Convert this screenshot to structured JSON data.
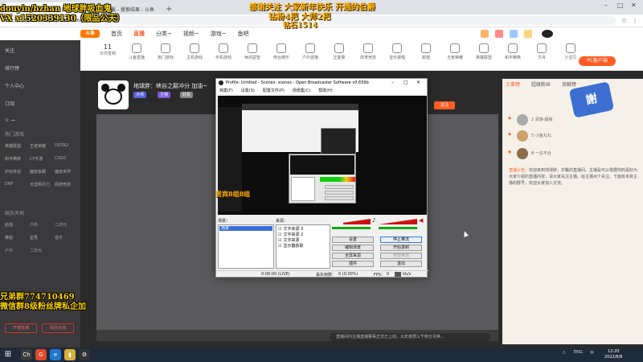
{
  "browser": {
    "tabs": [
      "【斗鱼】你的个人直播平台",
      "地球胖：护鬣 - 搜索结果 - 斗鱼"
    ],
    "new_tab": "+",
    "url": "https://www.douyu.com"
  },
  "site": {
    "logo": "斗鱼",
    "nav": [
      "首页",
      "直播",
      "分类~",
      "视频~",
      "游戏~",
      "鱼吧"
    ],
    "nav_active_index": 1,
    "categories": [
      {
        "label": "11",
        "sub": "日日签到"
      },
      {
        "label": "",
        "sub": "斗鱼直播"
      },
      {
        "label": "",
        "sub": "热门游戏"
      },
      {
        "label": "",
        "sub": "主机游戏"
      },
      {
        "label": "",
        "sub": "手机游戏"
      },
      {
        "label": "",
        "sub": "休闲益智"
      },
      {
        "label": "",
        "sub": "电台娱乐"
      },
      {
        "label": "",
        "sub": "户外直播"
      },
      {
        "label": "",
        "sub": "正能量"
      },
      {
        "label": "",
        "sub": "体育竞技"
      },
      {
        "label": "",
        "sub": "音乐歌唱"
      },
      {
        "label": "",
        "sub": "颜值"
      },
      {
        "label": "",
        "sub": "王者荣耀"
      },
      {
        "label": "",
        "sub": "英雄联盟"
      },
      {
        "label": "",
        "sub": "和平精英"
      },
      {
        "label": "",
        "sub": "方舟"
      },
      {
        "label": "",
        "sub": "小宝贝"
      }
    ],
    "pc_button": "PC客户端"
  },
  "sidebar": {
    "items": [
      "关注",
      "排行榜",
      "个人中心",
      "订阅"
    ],
    "section_hot": "热门游戏",
    "hot_grid": [
      "英雄联盟",
      "王者荣耀",
      "DOTA2",
      "和平精英",
      "CF手游",
      "CSGO",
      "炉石传说",
      "魔兽争霸",
      "魔兽世界",
      "DNF",
      "天涯明月刀",
      "网游竞技"
    ],
    "section_ent": "娱乐天地",
    "ent_grid": [
      "颜值",
      "户外",
      "二次元",
      "舞蹈",
      "星秀",
      "音乐",
      "户外",
      "二次元"
    ],
    "btn_left": "开播直播",
    "btn_right": "找回充值"
  },
  "room": {
    "streamer": "地球胖",
    "title": "峡谷之巅冲分 加油~",
    "tags": [
      "大师",
      "主播",
      "好友"
    ],
    "follow": "关注",
    "notice": "直播间内主播直播赛事正式已上线，大年夜攒三千积分兑换..."
  },
  "right_panel": {
    "tabs": [
      "土豪榜",
      "超级粉丝",
      "贡献榜"
    ],
    "mascot": "謝",
    "ranks": [
      "2 贵族-超级",
      "5 小鱼丸丸",
      "8 一言不合"
    ],
    "announcement_label": "直播公告：",
    "announcement": "欢迎来到地球胖，护鬣的直播间。主播是可以根据你的喜好为大家介绍的直播内容，请大家关注主播，给主播点个关注。下面有本房主播的群号，欢迎大家加入交流。"
  },
  "obs": {
    "title": "Profile: Untitled - Scenes: scenes - Open Broadcaster Software v0.659b",
    "menu": [
      "档案(F)",
      "设置(S)",
      "配置文件(P)",
      "场景集(C)",
      "帮助(H)"
    ],
    "scenes_label": "场景：",
    "scene_selected": "场景",
    "sources_label": "来源：",
    "sources": [
      "文字来源 3",
      "文字来源 2",
      "文字来源",
      "显示器获取"
    ],
    "buttons": [
      "设置",
      "停止推流",
      "编辑场景",
      "开始录制",
      "全屏来源",
      "预览推流",
      "插件",
      "退出"
    ],
    "status_time": "0:00:00 (LIVE)",
    "status_dropped": "丢失帧数：",
    "status_dropped_val": "0 (0.00%)",
    "status_fps": "FPS：",
    "status_fps_val": "0",
    "status_kbps": "kb/s"
  },
  "overlays": {
    "top_left_1": "douyin/bzhan  地球胖吸血鬼",
    "top_left_2": "VX x1520339130（限品公天）",
    "top_center_1": "感谢关注 大家新年快乐 开通的伯爵",
    "top_center_2": "钻粉4把 大师2把",
    "top_center_3": "钻石1514",
    "mid_left": "贵宾8组8组",
    "bottom_left_1": "兄弟群774710469",
    "bottom_left_2": "微信群8级粉丝牌私企加"
  },
  "taskbar": {
    "start": "⊞",
    "apps": [
      "Ch",
      "G",
      "e",
      "▮",
      "⚙"
    ],
    "tray": [
      "△",
      "ENG",
      "中"
    ],
    "time": "12:20",
    "date": "2022/6/6"
  },
  "colors": {
    "accent": "#ff5d23",
    "obs_selection": "#3a6fd8",
    "overlay_yellow": "#ffd400"
  }
}
